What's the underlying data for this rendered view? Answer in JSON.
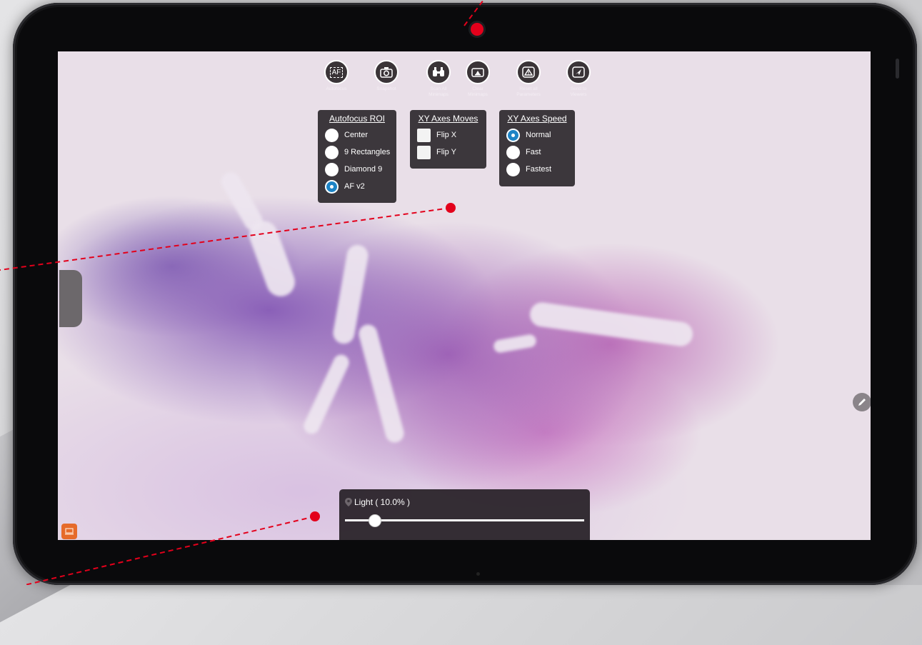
{
  "toolbar": {
    "autofocus": {
      "icon_text": "AF",
      "label": "Autofocus"
    },
    "snapshot": {
      "label": "Snapshot"
    },
    "scan_all": {
      "label_line1": "Scan All",
      "label_line2": "Minimaps"
    },
    "clear_minimaps": {
      "label_line1": "Clear",
      "label_line2": "Minimaps"
    },
    "reset_params": {
      "label_line1": "Reset all",
      "label_line2": "Parameters"
    },
    "send_viewers": {
      "label_line1": "Send to",
      "label_line2": "Viewers"
    }
  },
  "autofocus_roi": {
    "title": "Autofocus ROI",
    "options": [
      {
        "label": "Center",
        "selected": false
      },
      {
        "label": "9 Rectangles",
        "selected": false
      },
      {
        "label": "Diamond 9",
        "selected": false
      },
      {
        "label": "AF v2",
        "selected": true
      }
    ]
  },
  "xy_axes_moves": {
    "title": "XY Axes Moves",
    "options": [
      {
        "label": "Flip X",
        "checked": false
      },
      {
        "label": "Flip Y",
        "checked": false
      }
    ]
  },
  "xy_axes_speed": {
    "title": "XY Axes Speed",
    "options": [
      {
        "label": "Normal",
        "selected": true
      },
      {
        "label": "Fast",
        "selected": false
      },
      {
        "label": "Fastest",
        "selected": false
      }
    ]
  },
  "light": {
    "label": "Light ( 10.0% )",
    "value_fraction": 0.1
  },
  "colors": {
    "accent_blue": "#1d84c6",
    "panel_bg": "#2d282d",
    "annotation_red": "#e3001b",
    "keyboard_button": "#e66b2a"
  },
  "icons": {
    "autofocus": "af-icon",
    "snapshot": "camera-icon",
    "scan_all": "binoculars-icon",
    "clear": "eraser-icon",
    "reset": "warning-icon",
    "send": "send-icon",
    "edit": "pencil-icon",
    "keyboard": "keyboard-icon",
    "light": "location-pin-icon"
  }
}
